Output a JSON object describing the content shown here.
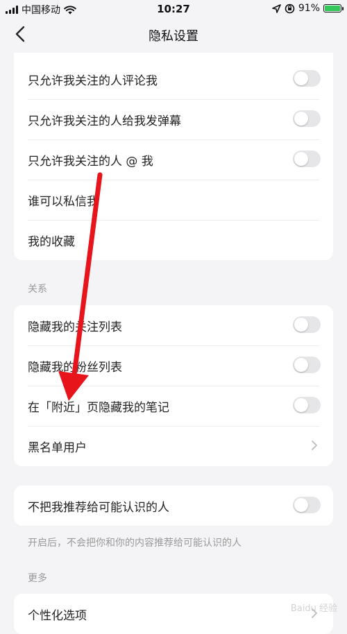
{
  "status_bar": {
    "carrier": "中国移动",
    "time": "10:27",
    "battery": "91%",
    "battery_level": 0.91
  },
  "nav": {
    "title": "隐私设置"
  },
  "card1": [
    {
      "label": "只允许我关注的人评论我",
      "control": "toggle",
      "on": false
    },
    {
      "label": "只允许我关注的人给我发弹幕",
      "control": "toggle",
      "on": false
    },
    {
      "label": "只允许我关注的人 @ 我",
      "control": "toggle",
      "on": false
    },
    {
      "label": "谁可以私信我",
      "control": "none"
    },
    {
      "label": "我的收藏",
      "control": "none"
    }
  ],
  "section_relation": "关系",
  "card2": [
    {
      "label": "隐藏我的关注列表",
      "control": "toggle",
      "on": false
    },
    {
      "label": "隐藏我的粉丝列表",
      "control": "toggle",
      "on": false
    },
    {
      "label": "在「附近」页隐藏我的笔记",
      "control": "toggle",
      "on": false
    },
    {
      "label": "黑名单用户",
      "control": "chevron"
    }
  ],
  "card3": [
    {
      "label": "不把我推荐给可能认识的人",
      "control": "toggle",
      "on": false
    }
  ],
  "card3_note": "开启后，不会把你和你的内容推荐给可能认识的人",
  "section_more": "更多",
  "card4": [
    {
      "label": "个性化选项",
      "control": "chevron"
    }
  ],
  "watermark": "Baidu 经验",
  "colors": {
    "arrow": "#e8141c",
    "toggle_off": "#e6e6e9",
    "battery": "#34c759"
  }
}
